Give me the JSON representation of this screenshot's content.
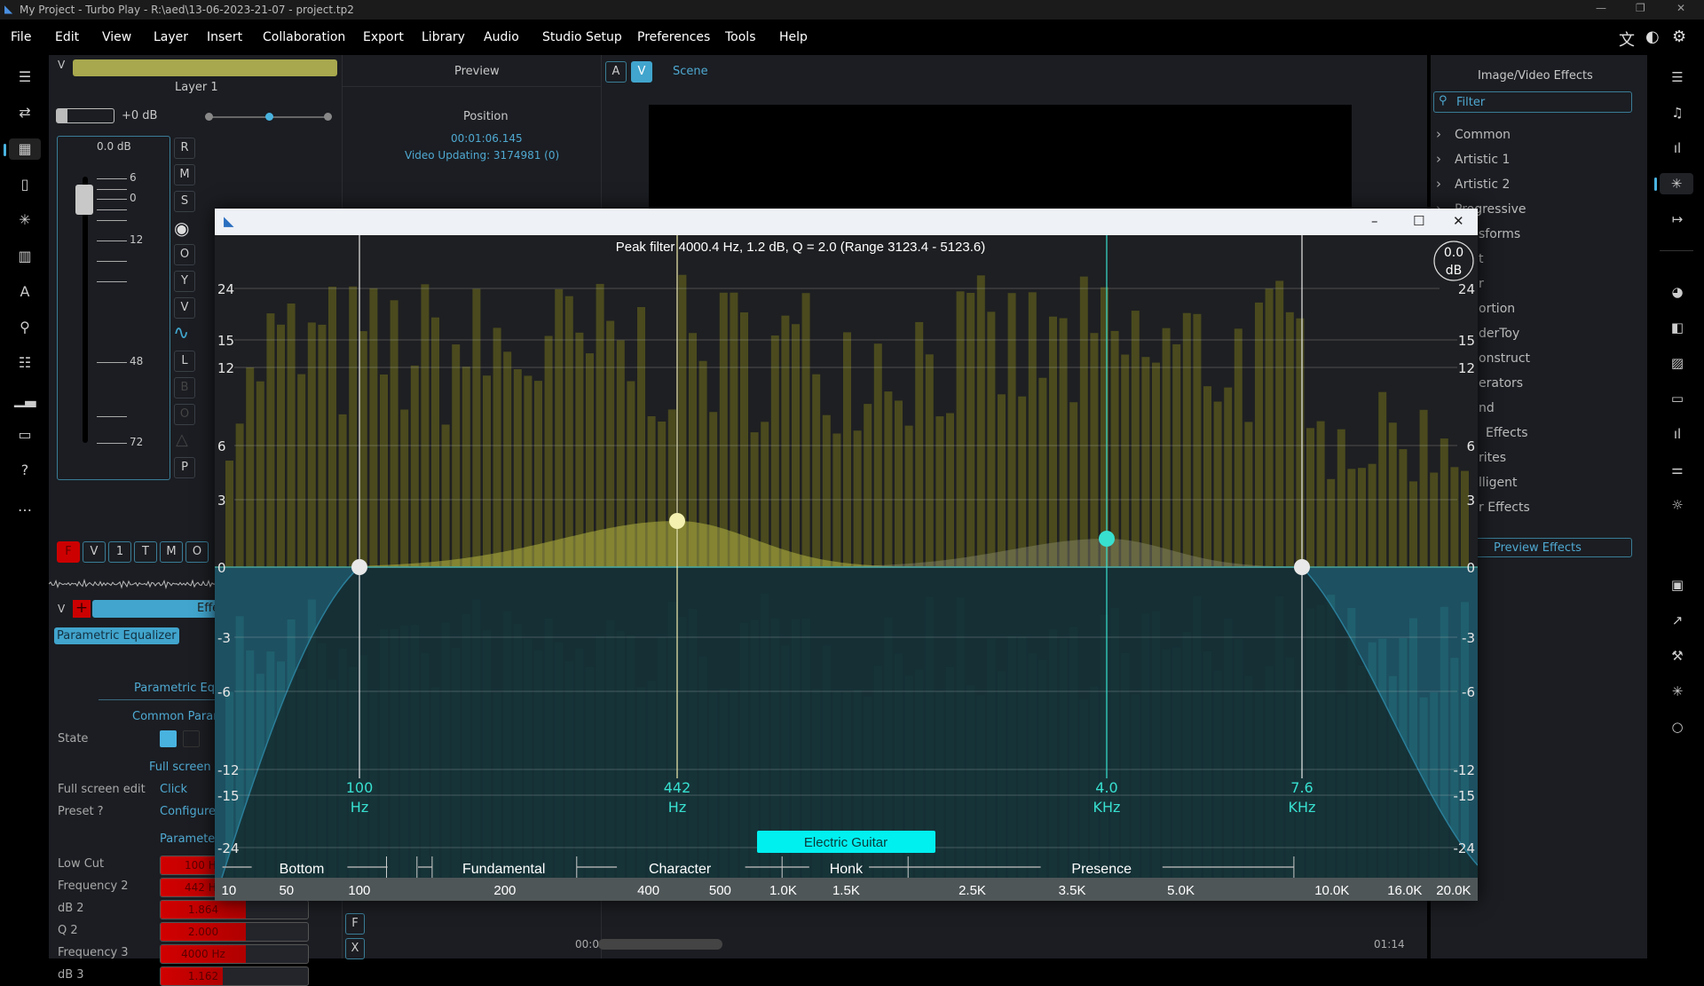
{
  "window": {
    "title": "My Project - Turbo Play - R:\\aed\\13-06-2023-21-07 - project.tp2",
    "controls": [
      "minimize",
      "restore",
      "close"
    ]
  },
  "menu": [
    "File",
    "Edit",
    "View",
    "Layer",
    "Insert",
    "Collaboration",
    "Export",
    "Library",
    "Audio",
    "Studio Setup",
    "Preferences",
    "Tools",
    "Help"
  ],
  "menu_icons": [
    "translate-icon",
    "palette-icon",
    "gear-icon"
  ],
  "left_strip": [
    "menu-icon",
    "transfer-icon",
    "grid-icon",
    "file-icon",
    "asterisk-icon",
    "library-icon",
    "text-icon",
    "pin-icon",
    "list-icon",
    "chart-icon",
    "folder-icon",
    "help-icon",
    "more-icon"
  ],
  "layer": {
    "collapse": "V",
    "name": "Layer 1",
    "color": "#a8a84e",
    "volume": "+0 dB",
    "fader_db": "0.0 dB",
    "fader_ticks": [
      "6",
      "0",
      "12",
      "48",
      "72"
    ],
    "side_buttons": [
      "R",
      "M",
      "S",
      "eye",
      "O",
      "Y",
      "V",
      "wave",
      "L",
      "B",
      "O",
      "triangle",
      "P"
    ],
    "bottom_buttons": [
      "F",
      "V",
      "1",
      "T",
      "M",
      "O"
    ],
    "effects_collapse": "V",
    "effects_add": "+",
    "effects_label": "Effe",
    "effect_chip": "Parametric Equalizer"
  },
  "params": {
    "section": "Parametric Equ",
    "common": "Common Parar",
    "state_label": "State",
    "fullscreen_section": "Full screen e",
    "fullscreen_label": "Full screen edit",
    "fullscreen_value": "Click",
    "preset_label": "Preset ?",
    "preset_value": "Configure",
    "parameters_section": "Parameter",
    "rows": [
      {
        "label": "Low Cut",
        "value": "100 Hz"
      },
      {
        "label": "Frequency 2",
        "value": "442 Hz"
      },
      {
        "label": "dB 2",
        "value": "1.864"
      },
      {
        "label": "Q 2",
        "value": "2.000"
      },
      {
        "label": "Frequency 3",
        "value": "4000 Hz"
      },
      {
        "label": "dB 3",
        "value": "1.162"
      }
    ]
  },
  "preview": {
    "header": "Preview",
    "position_label": "Position",
    "position": "00:01:06.145",
    "status": "Video Updating: 3174981 (0)"
  },
  "scene": {
    "a": "A",
    "v": "V",
    "label": "Scene"
  },
  "timeline": {
    "start": "00:00",
    "end": "01:14",
    "side_buttons": [
      "F",
      "X"
    ]
  },
  "effects": {
    "title": "Image/Video Effects",
    "filter_placeholder": "Filter",
    "categories": [
      "Common",
      "Artistic 1",
      "Artistic 2",
      "Progressive"
    ],
    "clipped": [
      "sforms",
      "t",
      "r",
      "ortion",
      "derToy",
      "onstruct",
      "erators",
      "nd",
      "Effects",
      "rites",
      "lligent",
      "r Effects"
    ],
    "preview_button": "Preview Effects"
  },
  "right_strip": [
    "menu-icon",
    "music-icon",
    "bars-icon",
    "asterisk-icon",
    "arrow-to-icon",
    "palette-icon",
    "contrast-icon",
    "image-icon",
    "monitor-icon",
    "bars-icon",
    "sliders-icon",
    "brightness-icon",
    "briefcase-icon",
    "share-icon",
    "tools-icon",
    "asterisk-icon",
    "circle-icon"
  ],
  "eq": {
    "info": "Peak filter 4000.4 Hz, 1.2 dB, Q = 2.0 (Range 3123.4 - 5123.6)",
    "gain_readout": [
      "0.0",
      "dB"
    ],
    "db_ticks": [
      "24",
      "15",
      "12",
      "6",
      "3",
      "0",
      "-3",
      "-6",
      "-12",
      "-15",
      "-24"
    ],
    "freq_ticks": [
      "10",
      "50",
      "100",
      "200",
      "400",
      "500",
      "1.0K",
      "1.5K",
      "2.5K",
      "3.5K",
      "5.0K",
      "10.0K",
      "16.0K",
      "20.0K"
    ],
    "bands": [
      "Bottom",
      "Fundamental",
      "Character",
      "Honk",
      "Presence"
    ],
    "preset_button": "Electric Guitar",
    "nodes": [
      {
        "value": "100",
        "unit": "Hz",
        "color": "#e8e8e8"
      },
      {
        "value": "442",
        "unit": "Hz",
        "color": "#f3f0b0"
      },
      {
        "value": "4.0",
        "unit": "KHz",
        "color": "#38e0d0"
      },
      {
        "value": "7.6",
        "unit": "KHz",
        "color": "#e8e8e8"
      }
    ],
    "accent": "#00f0f0"
  }
}
